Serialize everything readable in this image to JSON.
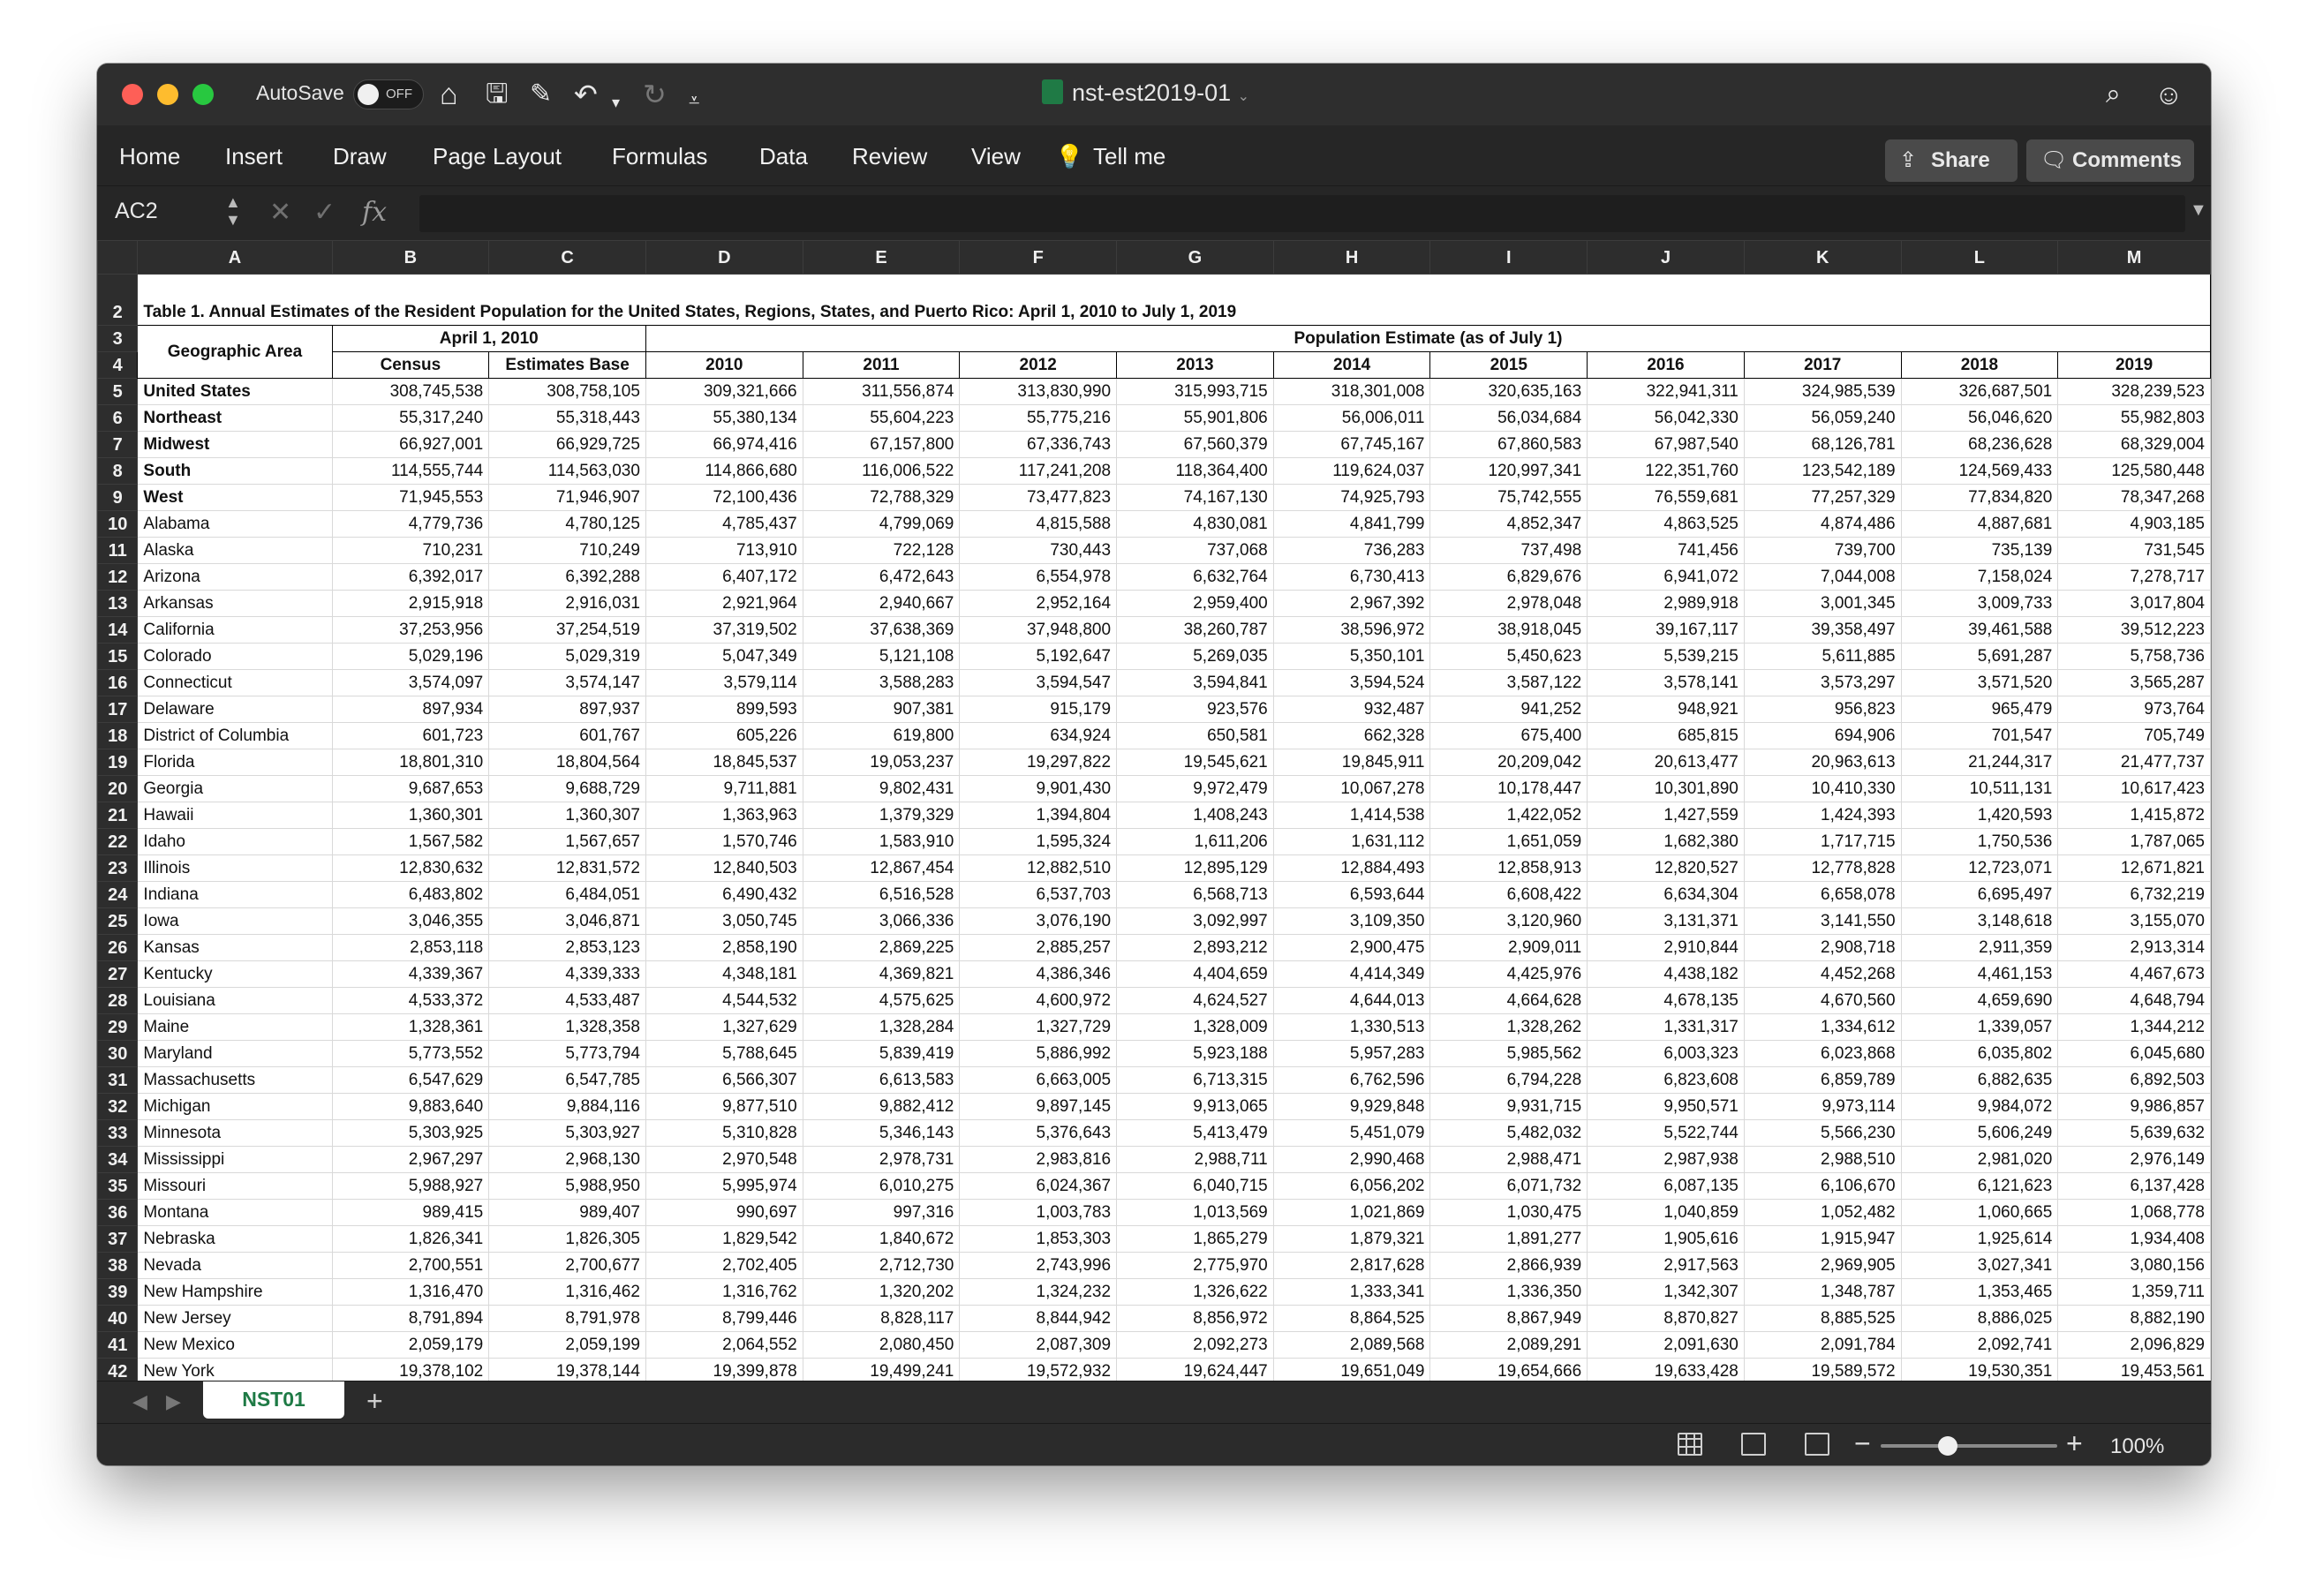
{
  "window": {
    "autosave_label": "AutoSave",
    "autosave_state": "OFF",
    "doc_title": "nst-est2019-01"
  },
  "ribbon": {
    "tabs": [
      "Home",
      "Insert",
      "Draw",
      "Page Layout",
      "Formulas",
      "Data",
      "Review",
      "View",
      "Tell me"
    ],
    "share_label": "Share",
    "comments_label": "Comments"
  },
  "formula_bar": {
    "cell_ref": "AC2",
    "fx_label": "fx",
    "content": ""
  },
  "columns": [
    "A",
    "B",
    "C",
    "D",
    "E",
    "F",
    "G",
    "H",
    "I",
    "J",
    "K",
    "L",
    "M"
  ],
  "sheet": {
    "title": "Table 1. Annual Estimates of the Resident Population for the United States, Regions, States, and Puerto Rico: April 1, 2010 to July 1, 2019",
    "geo_header": "Geographic Area",
    "april_header": "April 1, 2010",
    "estimate_header": "Population Estimate (as of July 1)",
    "sub_headers": [
      "Census",
      "Estimates Base",
      "2010",
      "2011",
      "2012",
      "2013",
      "2014",
      "2015",
      "2016",
      "2017",
      "2018",
      "2019"
    ],
    "rows": [
      {
        "area": "United States",
        "bold": true,
        "values": [
          "308,745,538",
          "308,758,105",
          "309,321,666",
          "311,556,874",
          "313,830,990",
          "315,993,715",
          "318,301,008",
          "320,635,163",
          "322,941,311",
          "324,985,539",
          "326,687,501",
          "328,239,523"
        ]
      },
      {
        "area": "Northeast",
        "bold": true,
        "values": [
          "55,317,240",
          "55,318,443",
          "55,380,134",
          "55,604,223",
          "55,775,216",
          "55,901,806",
          "56,006,011",
          "56,034,684",
          "56,042,330",
          "56,059,240",
          "56,046,620",
          "55,982,803"
        ]
      },
      {
        "area": "Midwest",
        "bold": true,
        "values": [
          "66,927,001",
          "66,929,725",
          "66,974,416",
          "67,157,800",
          "67,336,743",
          "67,560,379",
          "67,745,167",
          "67,860,583",
          "67,987,540",
          "68,126,781",
          "68,236,628",
          "68,329,004"
        ]
      },
      {
        "area": "South",
        "bold": true,
        "values": [
          "114,555,744",
          "114,563,030",
          "114,866,680",
          "116,006,522",
          "117,241,208",
          "118,364,400",
          "119,624,037",
          "120,997,341",
          "122,351,760",
          "123,542,189",
          "124,569,433",
          "125,580,448"
        ]
      },
      {
        "area": "West",
        "bold": true,
        "values": [
          "71,945,553",
          "71,946,907",
          "72,100,436",
          "72,788,329",
          "73,477,823",
          "74,167,130",
          "74,925,793",
          "75,742,555",
          "76,559,681",
          "77,257,329",
          "77,834,820",
          "78,347,268"
        ]
      },
      {
        "area": "Alabama",
        "values": [
          "4,779,736",
          "4,780,125",
          "4,785,437",
          "4,799,069",
          "4,815,588",
          "4,830,081",
          "4,841,799",
          "4,852,347",
          "4,863,525",
          "4,874,486",
          "4,887,681",
          "4,903,185"
        ]
      },
      {
        "area": "Alaska",
        "values": [
          "710,231",
          "710,249",
          "713,910",
          "722,128",
          "730,443",
          "737,068",
          "736,283",
          "737,498",
          "741,456",
          "739,700",
          "735,139",
          "731,545"
        ]
      },
      {
        "area": "Arizona",
        "values": [
          "6,392,017",
          "6,392,288",
          "6,407,172",
          "6,472,643",
          "6,554,978",
          "6,632,764",
          "6,730,413",
          "6,829,676",
          "6,941,072",
          "7,044,008",
          "7,158,024",
          "7,278,717"
        ]
      },
      {
        "area": "Arkansas",
        "values": [
          "2,915,918",
          "2,916,031",
          "2,921,964",
          "2,940,667",
          "2,952,164",
          "2,959,400",
          "2,967,392",
          "2,978,048",
          "2,989,918",
          "3,001,345",
          "3,009,733",
          "3,017,804"
        ]
      },
      {
        "area": "California",
        "values": [
          "37,253,956",
          "37,254,519",
          "37,319,502",
          "37,638,369",
          "37,948,800",
          "38,260,787",
          "38,596,972",
          "38,918,045",
          "39,167,117",
          "39,358,497",
          "39,461,588",
          "39,512,223"
        ]
      },
      {
        "area": "Colorado",
        "values": [
          "5,029,196",
          "5,029,319",
          "5,047,349",
          "5,121,108",
          "5,192,647",
          "5,269,035",
          "5,350,101",
          "5,450,623",
          "5,539,215",
          "5,611,885",
          "5,691,287",
          "5,758,736"
        ]
      },
      {
        "area": "Connecticut",
        "values": [
          "3,574,097",
          "3,574,147",
          "3,579,114",
          "3,588,283",
          "3,594,547",
          "3,594,841",
          "3,594,524",
          "3,587,122",
          "3,578,141",
          "3,573,297",
          "3,571,520",
          "3,565,287"
        ]
      },
      {
        "area": "Delaware",
        "values": [
          "897,934",
          "897,937",
          "899,593",
          "907,381",
          "915,179",
          "923,576",
          "932,487",
          "941,252",
          "948,921",
          "956,823",
          "965,479",
          "973,764"
        ]
      },
      {
        "area": "District of Columbia",
        "values": [
          "601,723",
          "601,767",
          "605,226",
          "619,800",
          "634,924",
          "650,581",
          "662,328",
          "675,400",
          "685,815",
          "694,906",
          "701,547",
          "705,749"
        ]
      },
      {
        "area": "Florida",
        "values": [
          "18,801,310",
          "18,804,564",
          "18,845,537",
          "19,053,237",
          "19,297,822",
          "19,545,621",
          "19,845,911",
          "20,209,042",
          "20,613,477",
          "20,963,613",
          "21,244,317",
          "21,477,737"
        ]
      },
      {
        "area": "Georgia",
        "values": [
          "9,687,653",
          "9,688,729",
          "9,711,881",
          "9,802,431",
          "9,901,430",
          "9,972,479",
          "10,067,278",
          "10,178,447",
          "10,301,890",
          "10,410,330",
          "10,511,131",
          "10,617,423"
        ]
      },
      {
        "area": "Hawaii",
        "values": [
          "1,360,301",
          "1,360,307",
          "1,363,963",
          "1,379,329",
          "1,394,804",
          "1,408,243",
          "1,414,538",
          "1,422,052",
          "1,427,559",
          "1,424,393",
          "1,420,593",
          "1,415,872"
        ]
      },
      {
        "area": "Idaho",
        "values": [
          "1,567,582",
          "1,567,657",
          "1,570,746",
          "1,583,910",
          "1,595,324",
          "1,611,206",
          "1,631,112",
          "1,651,059",
          "1,682,380",
          "1,717,715",
          "1,750,536",
          "1,787,065"
        ]
      },
      {
        "area": "Illinois",
        "values": [
          "12,830,632",
          "12,831,572",
          "12,840,503",
          "12,867,454",
          "12,882,510",
          "12,895,129",
          "12,884,493",
          "12,858,913",
          "12,820,527",
          "12,778,828",
          "12,723,071",
          "12,671,821"
        ]
      },
      {
        "area": "Indiana",
        "values": [
          "6,483,802",
          "6,484,051",
          "6,490,432",
          "6,516,528",
          "6,537,703",
          "6,568,713",
          "6,593,644",
          "6,608,422",
          "6,634,304",
          "6,658,078",
          "6,695,497",
          "6,732,219"
        ]
      },
      {
        "area": "Iowa",
        "values": [
          "3,046,355",
          "3,046,871",
          "3,050,745",
          "3,066,336",
          "3,076,190",
          "3,092,997",
          "3,109,350",
          "3,120,960",
          "3,131,371",
          "3,141,550",
          "3,148,618",
          "3,155,070"
        ]
      },
      {
        "area": "Kansas",
        "values": [
          "2,853,118",
          "2,853,123",
          "2,858,190",
          "2,869,225",
          "2,885,257",
          "2,893,212",
          "2,900,475",
          "2,909,011",
          "2,910,844",
          "2,908,718",
          "2,911,359",
          "2,913,314"
        ]
      },
      {
        "area": "Kentucky",
        "values": [
          "4,339,367",
          "4,339,333",
          "4,348,181",
          "4,369,821",
          "4,386,346",
          "4,404,659",
          "4,414,349",
          "4,425,976",
          "4,438,182",
          "4,452,268",
          "4,461,153",
          "4,467,673"
        ]
      },
      {
        "area": "Louisiana",
        "values": [
          "4,533,372",
          "4,533,487",
          "4,544,532",
          "4,575,625",
          "4,600,972",
          "4,624,527",
          "4,644,013",
          "4,664,628",
          "4,678,135",
          "4,670,560",
          "4,659,690",
          "4,648,794"
        ]
      },
      {
        "area": "Maine",
        "values": [
          "1,328,361",
          "1,328,358",
          "1,327,629",
          "1,328,284",
          "1,327,729",
          "1,328,009",
          "1,330,513",
          "1,328,262",
          "1,331,317",
          "1,334,612",
          "1,339,057",
          "1,344,212"
        ]
      },
      {
        "area": "Maryland",
        "values": [
          "5,773,552",
          "5,773,794",
          "5,788,645",
          "5,839,419",
          "5,886,992",
          "5,923,188",
          "5,957,283",
          "5,985,562",
          "6,003,323",
          "6,023,868",
          "6,035,802",
          "6,045,680"
        ]
      },
      {
        "area": "Massachusetts",
        "values": [
          "6,547,629",
          "6,547,785",
          "6,566,307",
          "6,613,583",
          "6,663,005",
          "6,713,315",
          "6,762,596",
          "6,794,228",
          "6,823,608",
          "6,859,789",
          "6,882,635",
          "6,892,503"
        ]
      },
      {
        "area": "Michigan",
        "values": [
          "9,883,640",
          "9,884,116",
          "9,877,510",
          "9,882,412",
          "9,897,145",
          "9,913,065",
          "9,929,848",
          "9,931,715",
          "9,950,571",
          "9,973,114",
          "9,984,072",
          "9,986,857"
        ]
      },
      {
        "area": "Minnesota",
        "values": [
          "5,303,925",
          "5,303,927",
          "5,310,828",
          "5,346,143",
          "5,376,643",
          "5,413,479",
          "5,451,079",
          "5,482,032",
          "5,522,744",
          "5,566,230",
          "5,606,249",
          "5,639,632"
        ]
      },
      {
        "area": "Mississippi",
        "values": [
          "2,967,297",
          "2,968,130",
          "2,970,548",
          "2,978,731",
          "2,983,816",
          "2,988,711",
          "2,990,468",
          "2,988,471",
          "2,987,938",
          "2,988,510",
          "2,981,020",
          "2,976,149"
        ]
      },
      {
        "area": "Missouri",
        "values": [
          "5,988,927",
          "5,988,950",
          "5,995,974",
          "6,010,275",
          "6,024,367",
          "6,040,715",
          "6,056,202",
          "6,071,732",
          "6,087,135",
          "6,106,670",
          "6,121,623",
          "6,137,428"
        ]
      },
      {
        "area": "Montana",
        "values": [
          "989,415",
          "989,407",
          "990,697",
          "997,316",
          "1,003,783",
          "1,013,569",
          "1,021,869",
          "1,030,475",
          "1,040,859",
          "1,052,482",
          "1,060,665",
          "1,068,778"
        ]
      },
      {
        "area": "Nebraska",
        "values": [
          "1,826,341",
          "1,826,305",
          "1,829,542",
          "1,840,672",
          "1,853,303",
          "1,865,279",
          "1,879,321",
          "1,891,277",
          "1,905,616",
          "1,915,947",
          "1,925,614",
          "1,934,408"
        ]
      },
      {
        "area": "Nevada",
        "values": [
          "2,700,551",
          "2,700,677",
          "2,702,405",
          "2,712,730",
          "2,743,996",
          "2,775,970",
          "2,817,628",
          "2,866,939",
          "2,917,563",
          "2,969,905",
          "3,027,341",
          "3,080,156"
        ]
      },
      {
        "area": "New Hampshire",
        "values": [
          "1,316,470",
          "1,316,462",
          "1,316,762",
          "1,320,202",
          "1,324,232",
          "1,326,622",
          "1,333,341",
          "1,336,350",
          "1,342,307",
          "1,348,787",
          "1,353,465",
          "1,359,711"
        ]
      },
      {
        "area": "New Jersey",
        "values": [
          "8,791,894",
          "8,791,978",
          "8,799,446",
          "8,828,117",
          "8,844,942",
          "8,856,972",
          "8,864,525",
          "8,867,949",
          "8,870,827",
          "8,885,525",
          "8,886,025",
          "8,882,190"
        ]
      },
      {
        "area": "New Mexico",
        "values": [
          "2,059,179",
          "2,059,199",
          "2,064,552",
          "2,080,450",
          "2,087,309",
          "2,092,273",
          "2,089,568",
          "2,089,291",
          "2,091,630",
          "2,091,784",
          "2,092,741",
          "2,096,829"
        ]
      },
      {
        "area": "New York",
        "values": [
          "19,378,102",
          "19,378,144",
          "19,399,878",
          "19,499,241",
          "19,572,932",
          "19,624,447",
          "19,651,049",
          "19,654,666",
          "19,633,428",
          "19,589,572",
          "19,530,351",
          "19,453,561"
        ]
      }
    ]
  },
  "sheet_tabs": {
    "active": "NST01",
    "add_label": "+"
  },
  "status": {
    "zoom_minus": "−",
    "zoom_plus": "+",
    "zoom_level": "100%",
    "zoom_fraction": 0.38
  }
}
